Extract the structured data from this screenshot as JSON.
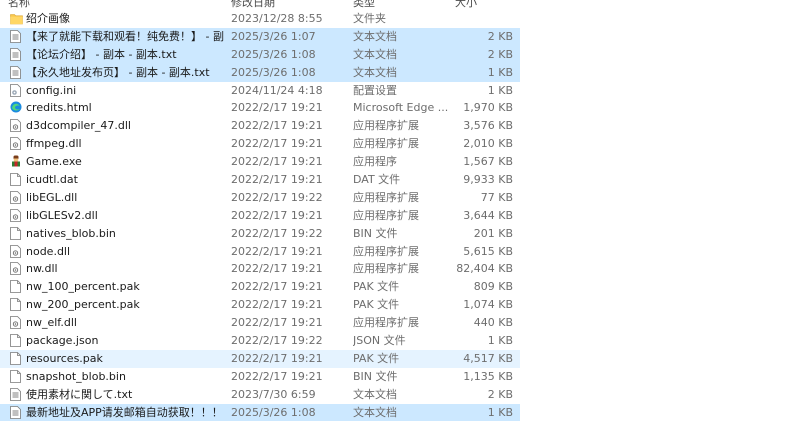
{
  "columns": {
    "name": "名称",
    "date": "修改日期",
    "type": "类型",
    "size": "大小"
  },
  "files": [
    {
      "icon": "folder-icon",
      "name": "绍介画像",
      "date": "2023/12/28 8:55",
      "type": "文件夹",
      "size": ""
    },
    {
      "icon": "text-file-icon",
      "name": "【来了就能下载和观看！纯免费！】 - 副...",
      "date": "2025/3/26 1:07",
      "type": "文本文档",
      "size": "2 KB",
      "state": "selected"
    },
    {
      "icon": "text-file-icon",
      "name": "【论坛介绍】 - 副本 - 副本.txt",
      "date": "2025/3/26 1:08",
      "type": "文本文档",
      "size": "2 KB",
      "state": "selected"
    },
    {
      "icon": "text-file-icon",
      "name": "【永久地址发布页】 - 副本 - 副本.txt",
      "date": "2025/3/26 1:08",
      "type": "文本文档",
      "size": "1 KB",
      "state": "selected"
    },
    {
      "icon": "config-file-icon",
      "name": "config.ini",
      "date": "2024/11/24 4:18",
      "type": "配置设置",
      "size": "1 KB"
    },
    {
      "icon": "edge-icon",
      "name": "credits.html",
      "date": "2022/2/17 19:21",
      "type": "Microsoft Edge ...",
      "size": "1,970 KB"
    },
    {
      "icon": "dll-file-icon",
      "name": "d3dcompiler_47.dll",
      "date": "2022/2/17 19:21",
      "type": "应用程序扩展",
      "size": "3,576 KB"
    },
    {
      "icon": "dll-file-icon",
      "name": "ffmpeg.dll",
      "date": "2022/2/17 19:21",
      "type": "应用程序扩展",
      "size": "2,010 KB"
    },
    {
      "icon": "game-exe-icon",
      "name": "Game.exe",
      "date": "2022/2/17 19:21",
      "type": "应用程序",
      "size": "1,567 KB"
    },
    {
      "icon": "blank-file-icon",
      "name": "icudtl.dat",
      "date": "2022/2/17 19:21",
      "type": "DAT 文件",
      "size": "9,933 KB"
    },
    {
      "icon": "dll-file-icon",
      "name": "libEGL.dll",
      "date": "2022/2/17 19:22",
      "type": "应用程序扩展",
      "size": "77 KB"
    },
    {
      "icon": "dll-file-icon",
      "name": "libGLESv2.dll",
      "date": "2022/2/17 19:21",
      "type": "应用程序扩展",
      "size": "3,644 KB"
    },
    {
      "icon": "blank-file-icon",
      "name": "natives_blob.bin",
      "date": "2022/2/17 19:22",
      "type": "BIN 文件",
      "size": "201 KB"
    },
    {
      "icon": "dll-file-icon",
      "name": "node.dll",
      "date": "2022/2/17 19:21",
      "type": "应用程序扩展",
      "size": "5,615 KB"
    },
    {
      "icon": "dll-file-icon",
      "name": "nw.dll",
      "date": "2022/2/17 19:21",
      "type": "应用程序扩展",
      "size": "82,404 KB"
    },
    {
      "icon": "blank-file-icon",
      "name": "nw_100_percent.pak",
      "date": "2022/2/17 19:21",
      "type": "PAK 文件",
      "size": "809 KB"
    },
    {
      "icon": "blank-file-icon",
      "name": "nw_200_percent.pak",
      "date": "2022/2/17 19:21",
      "type": "PAK 文件",
      "size": "1,074 KB"
    },
    {
      "icon": "dll-file-icon",
      "name": "nw_elf.dll",
      "date": "2022/2/17 19:21",
      "type": "应用程序扩展",
      "size": "440 KB"
    },
    {
      "icon": "blank-file-icon",
      "name": "package.json",
      "date": "2022/2/17 19:22",
      "type": "JSON 文件",
      "size": "1 KB"
    },
    {
      "icon": "blank-file-icon",
      "name": "resources.pak",
      "date": "2022/2/17 19:21",
      "type": "PAK 文件",
      "size": "4,517 KB",
      "state": "hover"
    },
    {
      "icon": "blank-file-icon",
      "name": "snapshot_blob.bin",
      "date": "2022/2/17 19:21",
      "type": "BIN 文件",
      "size": "1,135 KB"
    },
    {
      "icon": "text-file-icon",
      "name": "使用素材に関して.txt",
      "date": "2023/7/30 6:59",
      "type": "文本文档",
      "size": "2 KB"
    },
    {
      "icon": "text-file-icon",
      "name": "最新地址及APP请发邮箱自动获取！！！ ...",
      "date": "2025/3/26 1:08",
      "type": "文本文档",
      "size": "1 KB",
      "state": "selected"
    }
  ]
}
